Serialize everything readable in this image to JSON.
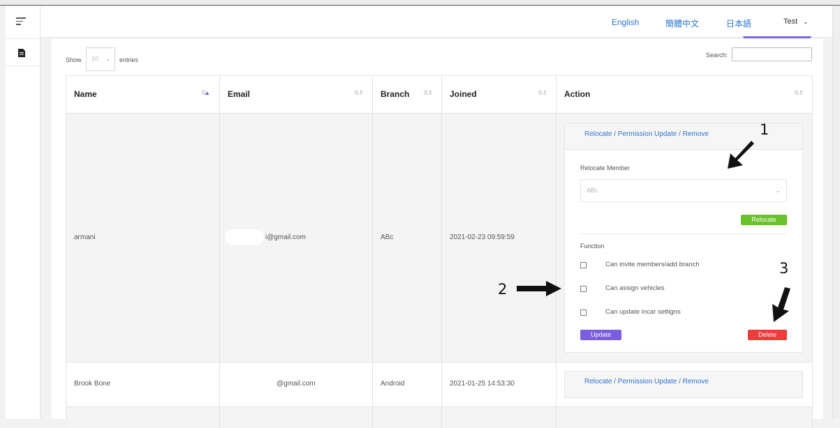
{
  "topbar": {
    "languages": [
      "English",
      "簡體中文",
      "日本語"
    ],
    "user": "Test"
  },
  "table_controls": {
    "show_label": "Show",
    "entries_value": "10",
    "entries_label": "entries",
    "search_label": "Search:"
  },
  "columns": [
    "Name",
    "Email",
    "Branch",
    "Joined",
    "Action"
  ],
  "rows": [
    {
      "name": "armani",
      "email": "i@gmail.com",
      "branch": "ABc",
      "joined": "2021-02-23 09:59:59"
    },
    {
      "name": "Brook Bone",
      "email": "@gmail.com",
      "branch": "Android",
      "joined": "2021-01-25 14:53:30"
    }
  ],
  "action_panel": {
    "link": "Relocate / Permission Update / Remove",
    "relocate_label": "Relocate Member",
    "relocate_select_value": "ABc",
    "relocate_button": "Relocate",
    "function_label": "Function",
    "functions": [
      "Can invite members/add branch",
      "Can assign vehicles",
      "Can update incar settigns"
    ],
    "update_button": "Update",
    "delete_button": "Delete"
  },
  "annotations": [
    "1",
    "2",
    "3"
  ],
  "colors": {
    "link": "#2a74d0",
    "relocate": "#6ac22b",
    "update": "#7b5ee0",
    "delete": "#ee3b3b"
  }
}
